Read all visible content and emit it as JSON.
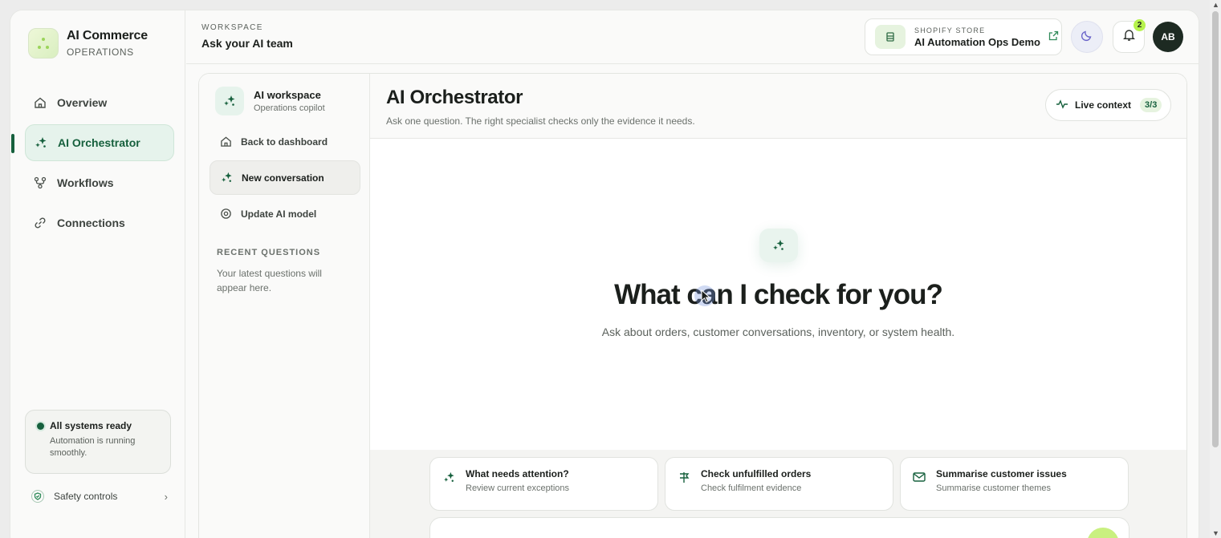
{
  "brand": {
    "title": "AI Commerce",
    "subtitle": "OPERATIONS"
  },
  "nav": [
    {
      "label": "Overview",
      "icon": "home-icon"
    },
    {
      "label": "AI Orchestrator",
      "icon": "sparkles-icon",
      "active": true
    },
    {
      "label": "Workflows",
      "icon": "workflow-icon"
    },
    {
      "label": "Connections",
      "icon": "link-icon"
    }
  ],
  "status": {
    "title": "All systems ready",
    "description": "Automation is running smoothly."
  },
  "safety": {
    "label": "Safety controls"
  },
  "topbar": {
    "workspace_label": "WORKSPACE",
    "workspace_title": "Ask your AI team",
    "store_label": "SHOPIFY STORE",
    "store_name": "AI Automation Ops Demo",
    "notification_count": "2",
    "avatar_initials": "AB"
  },
  "convo": {
    "title": "AI workspace",
    "subtitle": "Operations copilot",
    "items": [
      {
        "label": "Back to dashboard",
        "icon": "home-icon"
      },
      {
        "label": "New conversation",
        "icon": "sparkles-icon",
        "active": true
      },
      {
        "label": "Update AI model",
        "icon": "settings-icon"
      }
    ],
    "recent_label": "RECENT QUESTIONS",
    "recent_empty": "Your latest questions will appear here."
  },
  "main": {
    "title": "AI Orchestrator",
    "subtitle": "Ask one question. The right specialist checks only the evidence it needs.",
    "live_label": "Live context",
    "live_count": "3/3",
    "hero_title": "What can I check for you?",
    "hero_subtitle": "Ask about orders, customer conversations, inventory, or system health."
  },
  "suggestions": [
    {
      "title": "What needs attention?",
      "desc": "Review current exceptions",
      "icon": "sparkles-icon"
    },
    {
      "title": "Check unfulfilled orders",
      "desc": "Check fulfilment evidence",
      "icon": "signpost-icon"
    },
    {
      "title": "Summarise customer issues",
      "desc": "Summarise customer themes",
      "icon": "mail-icon"
    }
  ],
  "colors": {
    "accent": "#16603d",
    "accent_soft": "#e6f3ec",
    "lime": "#b6f24c"
  }
}
